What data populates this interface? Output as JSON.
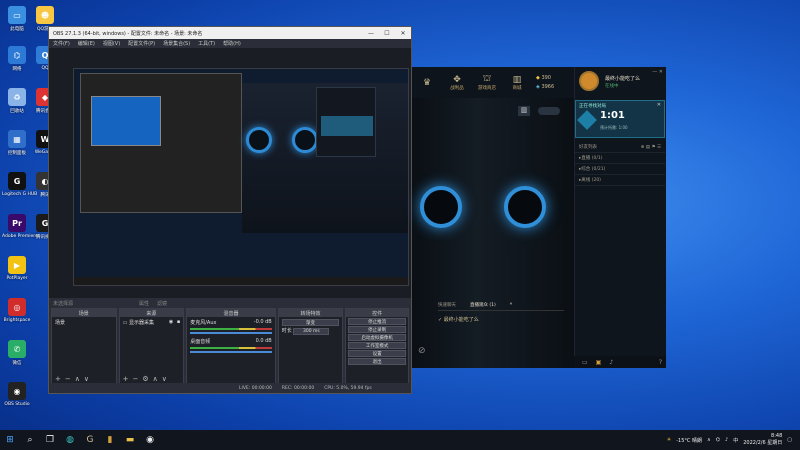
{
  "desktop": {
    "icons": [
      {
        "label": "此电脑",
        "color": "#3b8fe0",
        "glyph": "▭"
      },
      {
        "label": "网络",
        "color": "#2d7ad6",
        "glyph": "⌬"
      },
      {
        "label": "回收站",
        "color": "#8ab4e8",
        "glyph": "♻"
      },
      {
        "label": "控制面板",
        "color": "#2f6fc9",
        "glyph": "▦"
      },
      {
        "label": "Logitech G HUB",
        "color": "#111",
        "glyph": "G"
      },
      {
        "label": "Adobe Premiere",
        "color": "#3a0a6a",
        "glyph": "Pr"
      },
      {
        "label": "PotPlayer",
        "color": "#f3c313",
        "glyph": "▶"
      },
      {
        "label": "Brightspace",
        "color": "#d12c2c",
        "glyph": "◎"
      },
      {
        "label": "微信",
        "color": "#2aae67",
        "glyph": "✆"
      },
      {
        "label": "OBS Studio",
        "color": "#222",
        "glyph": "◉"
      }
    ],
    "icons2": [
      {
        "label": "QQ游戏",
        "color": "#f7c744",
        "glyph": "☻"
      },
      {
        "label": "QQ",
        "color": "#2e7bd8",
        "glyph": "Q"
      },
      {
        "label": "腾讯会议",
        "color": "#d33",
        "glyph": "◆"
      },
      {
        "label": "WeGame",
        "color": "#111",
        "glyph": "W"
      },
      {
        "label": "腾讯",
        "color": "#333",
        "glyph": "◐"
      },
      {
        "label": "腾讯视频",
        "color": "#1a1a1a",
        "glyph": "G"
      }
    ]
  },
  "obs": {
    "title": "OBS 27.1.3 (64-bit, windows) - 配置文件: 未命名 - 场景: 未命名",
    "menu": [
      "文件(F)",
      "编辑(E)",
      "视图(V)",
      "配置文件(P)",
      "场景集合(S)",
      "工具(T)",
      "帮助(H)"
    ],
    "dock_row": [
      "未选择源",
      "属性",
      "滤镜"
    ],
    "docks": {
      "scenes": {
        "title": "场景",
        "items": [
          "场景"
        ]
      },
      "sources": {
        "title": "来源",
        "items": [
          "显示器采集"
        ]
      },
      "mixer": {
        "title": "混音器",
        "tracks": [
          {
            "name": "麦克风/Aux",
            "db": "-0.0 dB"
          },
          {
            "name": "桌面音频",
            "db": "0.0 dB"
          }
        ]
      },
      "transitions": {
        "title": "转场特效",
        "type": "渐变",
        "duration_label": "时长",
        "duration": "300 ms"
      },
      "controls": {
        "title": "控件",
        "buttons": [
          "停止推流",
          "停止录制",
          "启动虚拟摄像机",
          "工作室模式",
          "设置",
          "退出"
        ]
      }
    },
    "status": [
      "LIVE: 00:00:00",
      "REC: 00:00:00",
      "CPU: 5.0%, 59.94 fps"
    ]
  },
  "game": {
    "tabs": [
      {
        "label": "",
        "glyph": "♛"
      },
      {
        "label": "战利品",
        "glyph": "✥"
      },
      {
        "label": "游戏商店",
        "glyph": "⛫"
      },
      {
        "label": "商城",
        "glyph": "▥"
      }
    ],
    "currency": [
      {
        "icon": "◆",
        "value": "390"
      },
      {
        "icon": "◈",
        "value": "3966"
      }
    ],
    "profile": {
      "name": "最终小能吃了么",
      "status": "在线中"
    },
    "queue": {
      "label": "正在寻找对局",
      "time": "1:01",
      "sub": "预计所需: 1:00"
    },
    "friends_title": "好友列表",
    "friends": [
      "直播 (0/1)",
      "综合 (0/21)",
      "离线 (20)"
    ],
    "chat": {
      "tab1": "快速聊天",
      "tab2": "直播观众 (1)",
      "row": "最终小能吃了么"
    }
  },
  "taskbar": {
    "weather": "-15°C 晴朗",
    "time": "8:48",
    "date": "2022/2/6 星期日"
  }
}
